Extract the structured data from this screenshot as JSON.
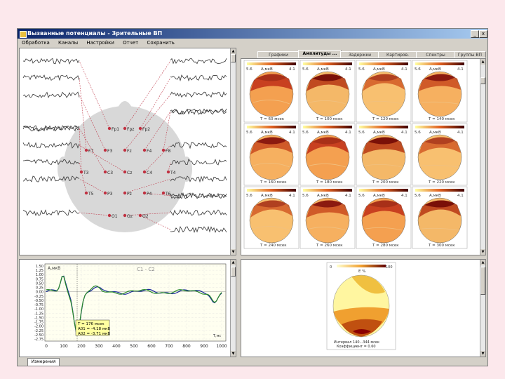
{
  "window": {
    "title": "Вызванные потенциалы - Зрительные ВП"
  },
  "menu": [
    "Обработка",
    "Каналы",
    "Настройки",
    "Отчет",
    "Сохранить"
  ],
  "tabs": [
    "Графики",
    "Амплитуды ...",
    "Задержки",
    "Картиров.",
    "Спектры",
    "Группы ВП"
  ],
  "electrodes": [
    "Fp1",
    "Fpz",
    "Fp2",
    "F7",
    "F3",
    "Fz",
    "F4",
    "F8",
    "T3",
    "C3",
    "Cz",
    "C4",
    "T4",
    "T5",
    "P3",
    "Pz",
    "P4",
    "T6",
    "O1",
    "Oz",
    "O2"
  ],
  "maps": {
    "scale_min": "5.6",
    "unit": "A,мкВ",
    "scale_max": "4.1",
    "times": [
      "T = 60 мсек",
      "T = 100 мсек",
      "T = 120 мсек",
      "T = 140 мсек",
      "T = 160 мсек",
      "T = 180 мсек",
      "T = 200 мсек",
      "T = 220 мсек",
      "T = 240 мсек",
      "T = 260 мсек",
      "T = 280 мсек",
      "T = 300 мсек"
    ]
  },
  "graph": {
    "unit": "A,мкВ",
    "legend": "C1 - C2",
    "y_ticks": [
      "1.50",
      "1.25",
      "1.00",
      "0.75",
      "0.50",
      "0.25",
      "0.00",
      "-0.25",
      "-0.50",
      "-0.75",
      "-1.00",
      "-1.25",
      "-1.50",
      "-1.75",
      "-2.00",
      "-2.25",
      "-2.50",
      "-2.75"
    ],
    "x_ticks": [
      "0",
      "100",
      "200",
      "300",
      "400",
      "500",
      "600",
      "700",
      "800",
      "900",
      "1000"
    ],
    "x_unit": "T,мс",
    "tooltip": [
      "T = 176 мсек",
      "A01 = -4.18 мкВ",
      "A02 = -3.71 мкВ"
    ]
  },
  "summary_map": {
    "scale_left": "0",
    "label": "E %",
    "scale_right": "100",
    "footer1": "Интервал 140...344 мсек",
    "footer2": "Коэффициент = 0.60"
  },
  "bottom_tab": "Измерения",
  "colors": {
    "titlebar": "#0a246a",
    "trace_blue": "#1a2a9a",
    "trace_green": "#2a8a2a",
    "head": "#d8d8d8",
    "map_hot": "#8b0000"
  }
}
